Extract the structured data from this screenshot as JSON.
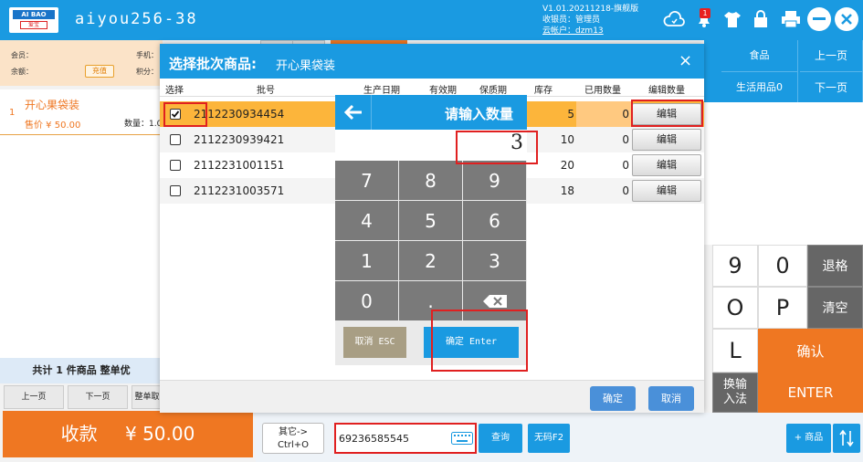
{
  "header": {
    "app_title": "aiyou256-38",
    "version": "V1.01.20211218-旗舰版",
    "cashier": "收银员：管理员",
    "cloud_account": "云帐户：dzm13",
    "notification_count": "1",
    "logo_text": "AI BAO",
    "logo_sub": "爱宝"
  },
  "member": {
    "member_label": "会员：",
    "phone_label": "手机：",
    "balance_label": "余额：",
    "points_label": "积分：",
    "recharge_label": "充值"
  },
  "cart": {
    "items": [
      {
        "index": "1",
        "name": "开心果袋装",
        "price": "售价 ¥ 50.00",
        "qty": "数量：1.0"
      }
    ],
    "summary": "共计 1 件商品 整单优",
    "prev_page": "上一页",
    "next_page": "下一页",
    "whole_order": "整单取",
    "pay_label": "收款",
    "pay_amount": "¥ 50.00"
  },
  "categories": {
    "food": "食品",
    "daily": "生活用品0",
    "prev_page": "上一页",
    "next_page": "下一页"
  },
  "keyboard": {
    "keys": [
      "9",
      "0",
      "退格",
      "O",
      "P",
      "清空",
      "L",
      "确认",
      "换输入法",
      "ENTER"
    ]
  },
  "bottom_bar": {
    "other_label": "其它->",
    "other_shortcut": "Ctrl+O",
    "barcode_value": "69236585545",
    "query_label": "查询",
    "no_code_label": "无码F2",
    "add_product_label": "+ 商品"
  },
  "dialog": {
    "title": "选择批次商品:",
    "product_name": "开心果袋装",
    "close_symbol": "×",
    "columns": [
      "选择",
      "批号",
      "生产日期",
      "有效期",
      "保质期",
      "库存",
      "已用数量",
      "编辑数量"
    ],
    "rows": [
      {
        "batch": "2112230934454",
        "stock": "5",
        "used": "0",
        "edit": "编辑",
        "checked": true
      },
      {
        "batch": "2112230939421",
        "stock": "10",
        "used": "0",
        "edit": "编辑",
        "checked": false
      },
      {
        "batch": "2112231001151",
        "stock": "20",
        "used": "0",
        "edit": "编辑",
        "checked": false
      },
      {
        "batch": "2112231003571",
        "stock": "18",
        "used": "0",
        "edit": "编辑",
        "checked": false
      }
    ],
    "confirm_label": "确定",
    "cancel_label": "取消"
  },
  "keypad": {
    "title": "请输入数量",
    "value": "3",
    "digits": [
      "7",
      "8",
      "9",
      "4",
      "5",
      "6",
      "1",
      "2",
      "3",
      "0",
      "."
    ],
    "cancel_label": "取消 ESC",
    "confirm_label": "确定 Enter"
  },
  "colors": {
    "primary": "#1a9ae1",
    "accent_orange": "#ef7722",
    "selected_row": "#fcb53b",
    "highlight_red": "#e02020"
  }
}
